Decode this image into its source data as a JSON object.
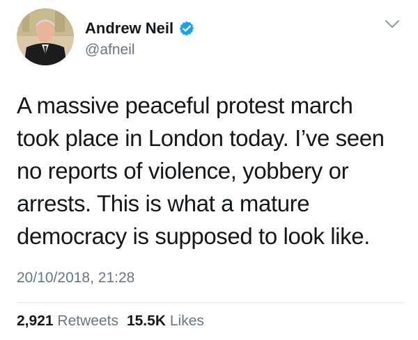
{
  "tweet": {
    "author": {
      "display_name": "Andrew Neil",
      "handle": "@afneil",
      "verified": true,
      "verified_color": "#1da1f2",
      "avatar_icon": "profile-photo"
    },
    "text_lines": [
      "A massive peaceful protest march",
      "took place in London today. I’ve seen",
      "no reports of violence, yobbery or",
      "arrests. This is what a mature",
      "democracy is supposed to look like."
    ],
    "timestamp": "20/10/2018, 21:28",
    "retweets": {
      "count": "2,921",
      "label": "Retweets"
    },
    "likes": {
      "count": "15.5K",
      "label": "Likes"
    }
  },
  "icons": {
    "verified": "verified-badge-icon",
    "menu": "chevron-down-icon"
  }
}
